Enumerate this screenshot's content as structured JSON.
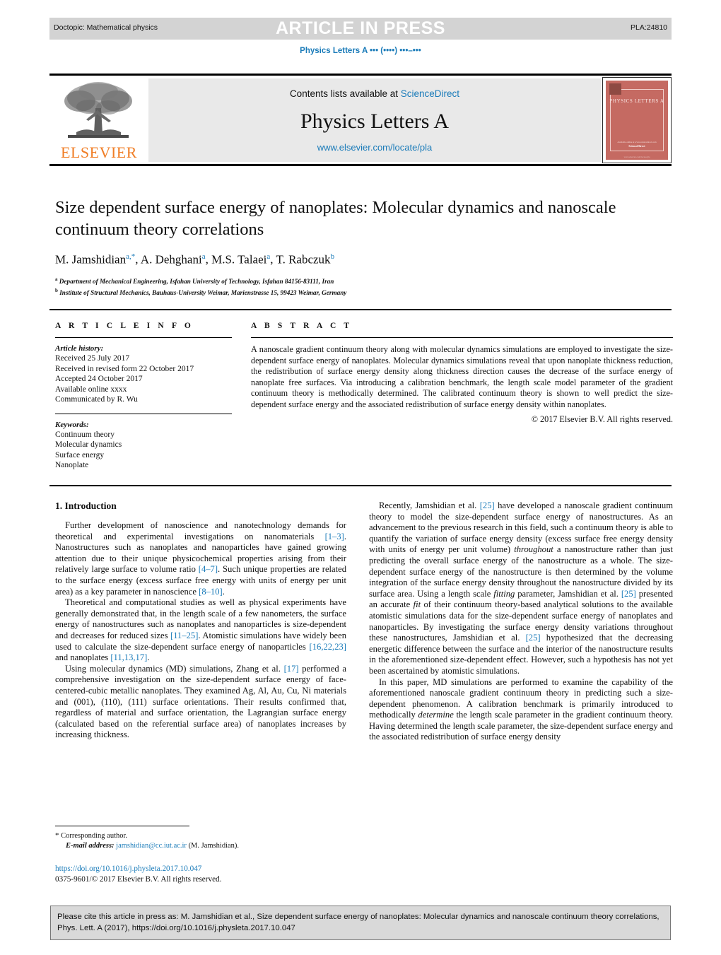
{
  "header": {
    "doctopic": "Doctopic: Mathematical physics",
    "press_banner": "ARTICLE IN PRESS",
    "article_id": "PLA:24810",
    "journal_ref": "Physics Letters A ••• (••••) •••–•••"
  },
  "masthead": {
    "contents_prefix": "Contents lists available at ",
    "sciencedirect": "ScienceDirect",
    "journal_title": "Physics Letters A",
    "journal_url": "www.elsevier.com/locate/pla",
    "publisher_wordmark": "ELSEVIER",
    "cover": {
      "title": "PHYSICS LETTERS A",
      "foot_line1": "Available online at www.sciencedirect.com",
      "foot_line2": "ScienceDirect",
      "foot_line3": "www.elsevier.com/locate/pla"
    }
  },
  "article": {
    "title": "Size dependent surface energy of nanoplates: Molecular dynamics and nanoscale continuum theory correlations",
    "authors_html": "M. Jamshidian<sup class=\"sup-aff\">a,*</sup>, A. Dehghani<sup class=\"sup-aff\">a</sup>, M.S. Talaei<sup class=\"sup-aff\">a</sup>, T. Rabczuk<sup class=\"sup-aff\">b</sup>",
    "affiliation_a": "Department of Mechanical Engineering, Isfahan University of Technology, Isfahan 84156-83111, Iran",
    "affiliation_b": "Institute of Structural Mechanics, Bauhaus-University Weimar, Marienstrasse 15, 99423 Weimar, Germany"
  },
  "article_info": {
    "heading": "A R T I C L E   I N F O",
    "history_label": "Article history:",
    "history": [
      "Received 25 July 2017",
      "Received in revised form 22 October 2017",
      "Accepted 24 October 2017",
      "Available online xxxx",
      "Communicated by R. Wu"
    ],
    "keywords_label": "Keywords:",
    "keywords": [
      "Continuum theory",
      "Molecular dynamics",
      "Surface energy",
      "Nanoplate"
    ]
  },
  "abstract": {
    "heading": "A B S T R A C T",
    "text": "A nanoscale gradient continuum theory along with molecular dynamics simulations are employed to investigate the size-dependent surface energy of nanoplates. Molecular dynamics simulations reveal that upon nanoplate thickness reduction, the redistribution of surface energy density along thickness direction causes the decrease of the surface energy of nanoplate free surfaces. Via introducing a calibration benchmark, the length scale model parameter of the gradient continuum theory is methodically determined. The calibrated continuum theory is shown to well predict the size-dependent surface energy and the associated redistribution of surface energy density within nanoplates.",
    "copyright": "© 2017 Elsevier B.V. All rights reserved."
  },
  "body": {
    "section_title": "1. Introduction",
    "left_paragraphs": [
      "Further development of nanoscience and nanotechnology demands for theoretical and experimental investigations on nanomaterials <span class=\"ref\">[1–3]</span>. Nanostructures such as nanoplates and nanoparticles have gained growing attention due to their unique physicochemical properties arising from their relatively large surface to volume ratio <span class=\"ref\">[4–7]</span>. Such unique properties are related to the surface energy (excess surface free energy with units of energy per unit area) as a key parameter in nanoscience <span class=\"ref\">[8–10]</span>.",
      "Theoretical and computational studies as well as physical experiments have generally demonstrated that, in the length scale of a few nanometers, the surface energy of nanostructures such as nanoplates and nanoparticles is size-dependent and decreases for reduced sizes <span class=\"ref\">[11–25]</span>. Atomistic simulations have widely been used to calculate the size-dependent surface energy of nanoparticles <span class=\"ref\">[16,22,23]</span> and nanoplates <span class=\"ref\">[11,13,17]</span>.",
      "Using molecular dynamics (MD) simulations, Zhang et al. <span class=\"ref\">[17]</span> performed a comprehensive investigation on the size-dependent surface energy of face-centered-cubic metallic nanoplates. They examined Ag, Al, Au, Cu, Ni materials and (001), (110), (111) surface orientations. Their results confirmed that, regardless of material and surface orientation, the Lagrangian surface energy (calculated based on the referential surface area) of nanoplates increases by increasing thickness."
    ],
    "right_paragraphs": [
      "Recently, Jamshidian et al. <span class=\"ref\">[25]</span> have developed a nanoscale gradient continuum theory to model the size-dependent surface energy of nanostructures. As an advancement to the previous research in this field, such a continuum theory is able to quantify the variation of surface energy density (excess surface free energy density with units of energy per unit volume) <span class=\"it\">throughout</span> a nanostructure rather than just predicting the overall surface energy of the nanostructure as a whole. The size-dependent surface energy of the nanostructure is then determined by the volume integration of the surface energy density throughout the nanostructure divided by its surface area. Using a length scale <span class=\"it\">fitting</span> parameter, Jamshidian et al. <span class=\"ref\">[25]</span> presented an accurate <span class=\"it\">fit</span> of their continuum theory-based analytical solutions to the available atomistic simulations data for the size-dependent surface energy of nanoplates and nanoparticles. By investigating the surface energy density variations throughout these nanostructures, Jamshidian et al. <span class=\"ref\">[25]</span> hypothesized that the decreasing energetic difference between the surface and the interior of the nanostructure results in the aforementioned size-dependent effect. However, such a hypothesis has not yet been ascertained by atomistic simulations.",
      "In this paper, MD simulations are performed to examine the capability of the aforementioned nanoscale gradient continuum theory in predicting such a size-dependent phenomenon. A calibration benchmark is primarily introduced to methodically <span class=\"it\">determine</span> the length scale parameter in the gradient continuum theory. Having determined the length scale parameter, the size-dependent surface energy and the associated redistribution of surface energy density"
    ]
  },
  "footnote": {
    "corresponding_marker": "*",
    "corresponding_text": "Corresponding author.",
    "email_label": "E-mail address:",
    "email": "jamshidian@cc.iut.ac.ir",
    "email_owner": "(M. Jamshidian).",
    "doi": "https://doi.org/10.1016/j.physleta.2017.10.047",
    "issn_line": "0375-9601/© 2017 Elsevier B.V. All rights reserved."
  },
  "cite_box": {
    "line1": "Please cite this article in press as: M. Jamshidian et al., Size dependent surface energy of nanoplates: Molecular dynamics and nanoscale continuum theory correlations,",
    "line2": "Phys. Lett. A (2017), https://doi.org/10.1016/j.physleta.2017.10.047"
  },
  "colors": {
    "link": "#1a7bb9",
    "elsevier_orange": "#f07e26",
    "band_gray": "#d3d3d3",
    "masthead_gray": "#e9e9e9",
    "cover_red": "#c56a62",
    "cite_box_gray": "#d9d9d9"
  }
}
